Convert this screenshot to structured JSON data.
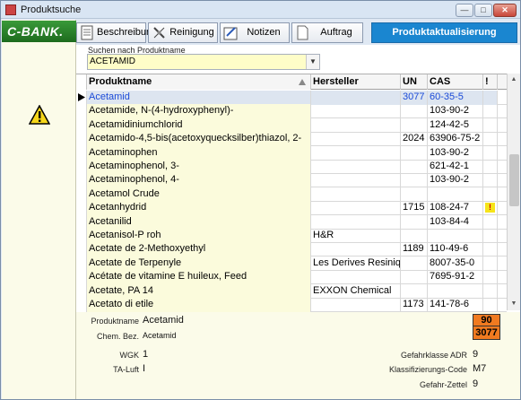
{
  "window": {
    "title": "Produktsuche"
  },
  "sidebar": {
    "logo": "C-BANK."
  },
  "toolbar": {
    "buttons": [
      {
        "label": "Beschreibung",
        "icon": "document-icon"
      },
      {
        "label": "Reinigung",
        "icon": "cleaning-icon"
      },
      {
        "label": "Notizen",
        "icon": "notes-icon"
      },
      {
        "label": "Auftrag",
        "icon": "page-icon"
      }
    ],
    "primary_label": "Produktaktualisierung"
  },
  "search": {
    "label": "Suchen nach Produktname",
    "value": "ACETAMID"
  },
  "grid": {
    "headers": {
      "name": "Produktname",
      "manufacturer": "Hersteller",
      "un": "UN",
      "cas": "CAS",
      "flag": "!"
    },
    "rows": [
      {
        "name": "Acetamid",
        "manufacturer": "",
        "un": "3077",
        "cas": "60-35-5",
        "flag": false
      },
      {
        "name": "Acetamide, N-(4-hydroxyphenyl)-",
        "manufacturer": "",
        "un": "",
        "cas": "103-90-2",
        "flag": false
      },
      {
        "name": "Acetamidiniumchlorid",
        "manufacturer": "",
        "un": "",
        "cas": "124-42-5",
        "flag": false
      },
      {
        "name": "Acetamido-4,5-bis(acetoxyquecksilber)thiazol, 2-",
        "manufacturer": "",
        "un": "2024",
        "cas": "63906-75-2",
        "flag": false
      },
      {
        "name": "Acetaminophen",
        "manufacturer": "",
        "un": "",
        "cas": "103-90-2",
        "flag": false
      },
      {
        "name": "Acetaminophenol, 3-",
        "manufacturer": "",
        "un": "",
        "cas": "621-42-1",
        "flag": false
      },
      {
        "name": "Acetaminophenol, 4-",
        "manufacturer": "",
        "un": "",
        "cas": "103-90-2",
        "flag": false
      },
      {
        "name": "Acetamol Crude",
        "manufacturer": "",
        "un": "",
        "cas": "",
        "flag": false
      },
      {
        "name": "Acetanhydrid",
        "manufacturer": "",
        "un": "1715",
        "cas": "108-24-7",
        "flag": true
      },
      {
        "name": "Acetanilid",
        "manufacturer": "",
        "un": "",
        "cas": "103-84-4",
        "flag": false
      },
      {
        "name": "Acetanisol-P roh",
        "manufacturer": "H&R",
        "un": "",
        "cas": "",
        "flag": false
      },
      {
        "name": "Acetate de 2-Methoxyethyl",
        "manufacturer": "",
        "un": "1189",
        "cas": "110-49-6",
        "flag": false
      },
      {
        "name": "Acetate de Terpenyle",
        "manufacturer": "Les Derives Resinique",
        "un": "",
        "cas": "8007-35-0",
        "flag": false
      },
      {
        "name": "Acétate de vitamine E huileux, Feed",
        "manufacturer": "",
        "un": "",
        "cas": "7695-91-2",
        "flag": false
      },
      {
        "name": "Acetate, PA 14",
        "manufacturer": "EXXON Chemical",
        "un": "",
        "cas": "",
        "flag": false
      },
      {
        "name": "Acetato di etile",
        "manufacturer": "",
        "un": "1173",
        "cas": "141-78-6",
        "flag": false
      }
    ],
    "flag_symbol": "!"
  },
  "details": {
    "produktname_label": "Produktname",
    "produktname": "Acetamid",
    "chem_label": "Chem. Bez.",
    "chem": "Acetamid",
    "wgk_label": "WGK",
    "wgk": "1",
    "taluft_label": "TA-Luft",
    "taluft": "I",
    "adr_label": "Gefahrklasse ADR",
    "adr": "9",
    "klass_label": "Klassifizierungs-Code",
    "klass": "M7",
    "zettel_label": "Gefahr-Zettel",
    "zettel": "9",
    "placard_top": "90",
    "placard_bottom": "3077"
  },
  "colors": {
    "primary": "#1a86d0",
    "logo": "#2a8a2a",
    "placard": "#f07a20",
    "selected_text": "#1a4ad8"
  }
}
